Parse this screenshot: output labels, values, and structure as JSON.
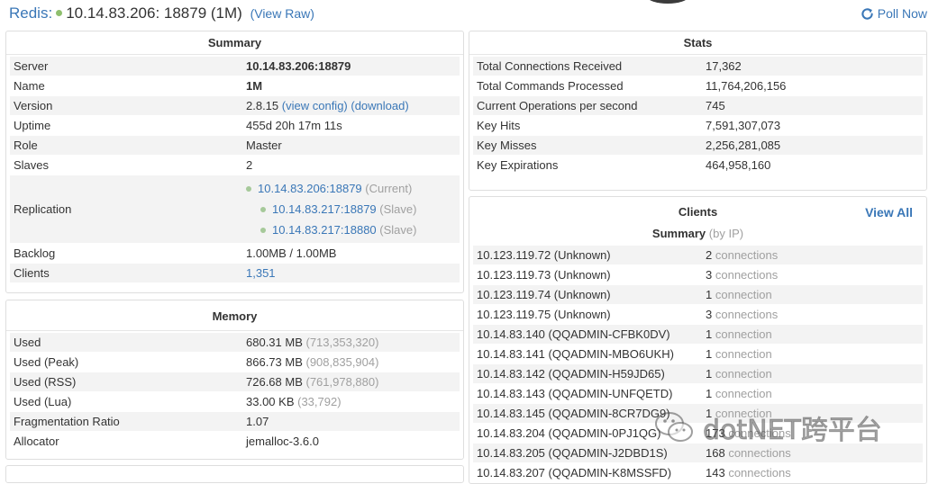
{
  "header": {
    "app": "Redis:",
    "instance": "10.14.83.206: 18879 (1M)",
    "view_raw": "(View Raw)",
    "poll_now": "Poll Now",
    "status_color": "#8fbf6e"
  },
  "summary": {
    "title": "Summary",
    "server_label": "Server",
    "server_value": "10.14.83.206:18879",
    "name_label": "Name",
    "name_value": "1M",
    "version_label": "Version",
    "version_value": "2.8.15",
    "view_config": "(view config)",
    "download": "(download)",
    "uptime_label": "Uptime",
    "uptime_value": "455d 20h 17m 11s",
    "role_label": "Role",
    "role_value": "Master",
    "slaves_label": "Slaves",
    "slaves_value": "2",
    "replication_label": "Replication",
    "replication": [
      {
        "host": "10.14.83.206:18879",
        "role": "(Current)"
      },
      {
        "host": "10.14.83.217:18879",
        "role": "(Slave)"
      },
      {
        "host": "10.14.83.217:18880",
        "role": "(Slave)"
      }
    ],
    "backlog_label": "Backlog",
    "backlog_value": "1.00MB / 1.00MB",
    "clients_label": "Clients",
    "clients_value": "1,351"
  },
  "memory": {
    "title": "Memory",
    "rows": [
      {
        "label": "Used",
        "value": "680.31 MB",
        "detail": "(713,353,320)"
      },
      {
        "label": "Used (Peak)",
        "value": "866.73 MB",
        "detail": "(908,835,904)"
      },
      {
        "label": "Used (RSS)",
        "value": "726.68 MB",
        "detail": "(761,978,880)"
      },
      {
        "label": "Used (Lua)",
        "value": "33.00 KB",
        "detail": "(33,792)"
      },
      {
        "label": "Fragmentation Ratio",
        "value": "1.07",
        "detail": ""
      },
      {
        "label": "Allocator",
        "value": "jemalloc-3.6.0",
        "detail": ""
      }
    ]
  },
  "stats": {
    "title": "Stats",
    "rows": [
      {
        "label": "Total Connections Received",
        "value": "17,362"
      },
      {
        "label": "Total Commands Processed",
        "value": "11,764,206,156"
      },
      {
        "label": "Current Operations per second",
        "value": "745"
      },
      {
        "label": "Key Hits",
        "value": "7,591,307,073"
      },
      {
        "label": "Key Misses",
        "value": "2,256,281,085"
      },
      {
        "label": "Key Expirations",
        "value": "464,958,160"
      }
    ]
  },
  "clients": {
    "title": "Clients",
    "view_all": "View All",
    "summary_title": "Summary",
    "summary_hint": "(by IP)",
    "rows": [
      {
        "host": "10.123.119.72 (Unknown)",
        "count": "2",
        "unit": "connections"
      },
      {
        "host": "10.123.119.73 (Unknown)",
        "count": "3",
        "unit": "connections"
      },
      {
        "host": "10.123.119.74 (Unknown)",
        "count": "1",
        "unit": "connection"
      },
      {
        "host": "10.123.119.75 (Unknown)",
        "count": "3",
        "unit": "connections"
      },
      {
        "host": "10.14.83.140 (QQADMIN-CFBK0DV)",
        "count": "1",
        "unit": "connection"
      },
      {
        "host": "10.14.83.141 (QQADMIN-MBO6UKH)",
        "count": "1",
        "unit": "connection"
      },
      {
        "host": "10.14.83.142 (QQADMIN-H59JD65)",
        "count": "1",
        "unit": "connection"
      },
      {
        "host": "10.14.83.143 (QQADMIN-UNFQETD)",
        "count": "1",
        "unit": "connection"
      },
      {
        "host": "10.14.83.145 (QQADMIN-8CR7DG9)",
        "count": "1",
        "unit": "connection"
      },
      {
        "host": "10.14.83.204 (QQADMIN-0PJ1QG)",
        "count": "173",
        "unit": "connections"
      },
      {
        "host": "10.14.83.205 (QQADMIN-J2DBD1S)",
        "count": "168",
        "unit": "connections"
      },
      {
        "host": "10.14.83.207 (QQADMIN-K8MSSFD)",
        "count": "143",
        "unit": "connections"
      }
    ]
  },
  "watermark": {
    "text": "dotNET跨平台",
    "icon": "wechat-icon"
  }
}
